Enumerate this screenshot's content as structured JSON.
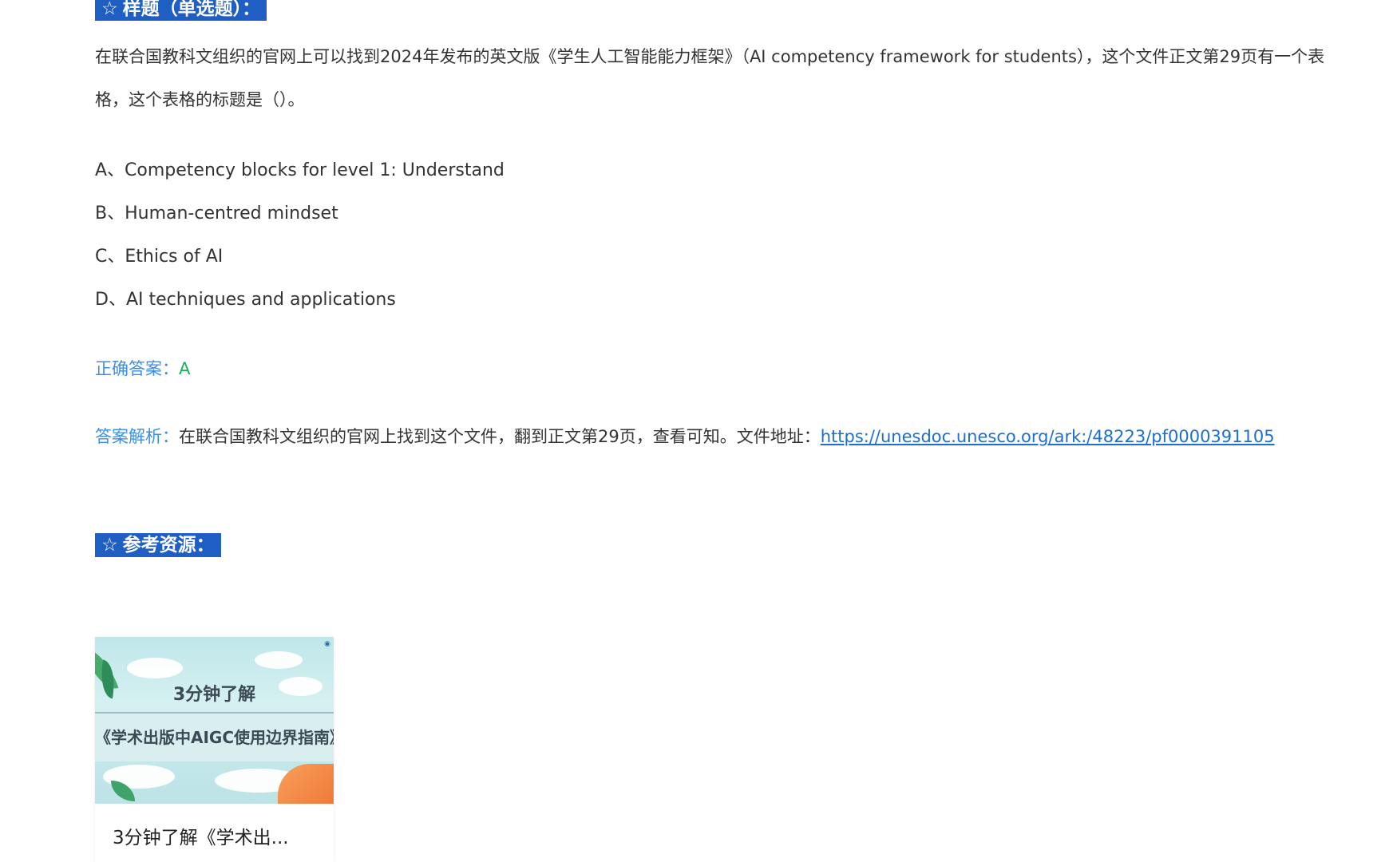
{
  "sample_section": {
    "star": "☆",
    "title": "样题（单选题）："
  },
  "question": {
    "text": "在联合国教科文组织的官网上可以找到2024年发布的英文版《学生人工智能能力框架》（AI competency framework for students），这个文件正文第29页有一个表格，这个表格的标题是（）。"
  },
  "options": [
    {
      "label": "A、Competency blocks for level 1: Understand"
    },
    {
      "label": "B、Human-centred mindset"
    },
    {
      "label": "C、Ethics of AI"
    },
    {
      "label": "D、AI techniques and applications"
    }
  ],
  "answer": {
    "label": "正确答案：",
    "value": "A"
  },
  "analysis": {
    "label": "答案解析：",
    "text": "在联合国教科文组织的官网上找到这个文件，翻到正文第29页，查看可知。文件地址：",
    "link": "https://unesdoc.unesco.org/ark:/48223/pf0000391105"
  },
  "refs_section": {
    "star": "☆",
    "title": "参考资源："
  },
  "resource_card": {
    "thumb_line1": "3分钟了解",
    "thumb_line2": "《学术出版中AIGC使用边界指南》",
    "card_title": "3分钟了解《学术出..."
  },
  "colors": {
    "tag_background": "#1f5fc4",
    "label_blue": "#3a8ee6",
    "answer_green": "#1db05b",
    "link_blue": "#1a6fd1"
  }
}
